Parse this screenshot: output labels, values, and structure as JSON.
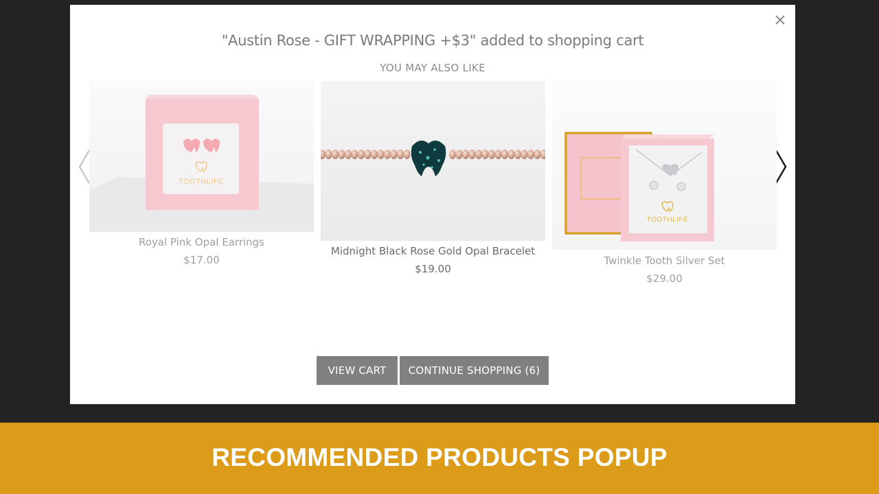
{
  "popup": {
    "headline": "\"Austin Rose - GIFT WRAPPING +$3\" added to shopping cart",
    "section_title": "YOU MAY ALSO LIKE",
    "close_icon": "close-icon",
    "prev_icon": "chevron-left-icon",
    "next_icon": "chevron-right-icon"
  },
  "products": [
    {
      "name": "Royal Pink Opal Earrings",
      "price": "$17.00",
      "box_brand": "TOOTHLIFE"
    },
    {
      "name": "Midnight Black Rose Gold Opal Bracelet",
      "price": "$19.00"
    },
    {
      "name": "Twinkle Tooth Silver Set",
      "price": "$29.00",
      "box_brand": "TOOTHLIFE"
    }
  ],
  "buttons": {
    "view_cart": "VIEW CART",
    "continue_shopping": "CONTINUE SHOPPING (6)"
  },
  "banner": {
    "text": "RECOMMENDED PRODUCTS POPUP"
  },
  "colors": {
    "overlay": "#232323",
    "button": "#808080",
    "banner": "#dc9b19",
    "box_pink": "#f6c8cf"
  }
}
